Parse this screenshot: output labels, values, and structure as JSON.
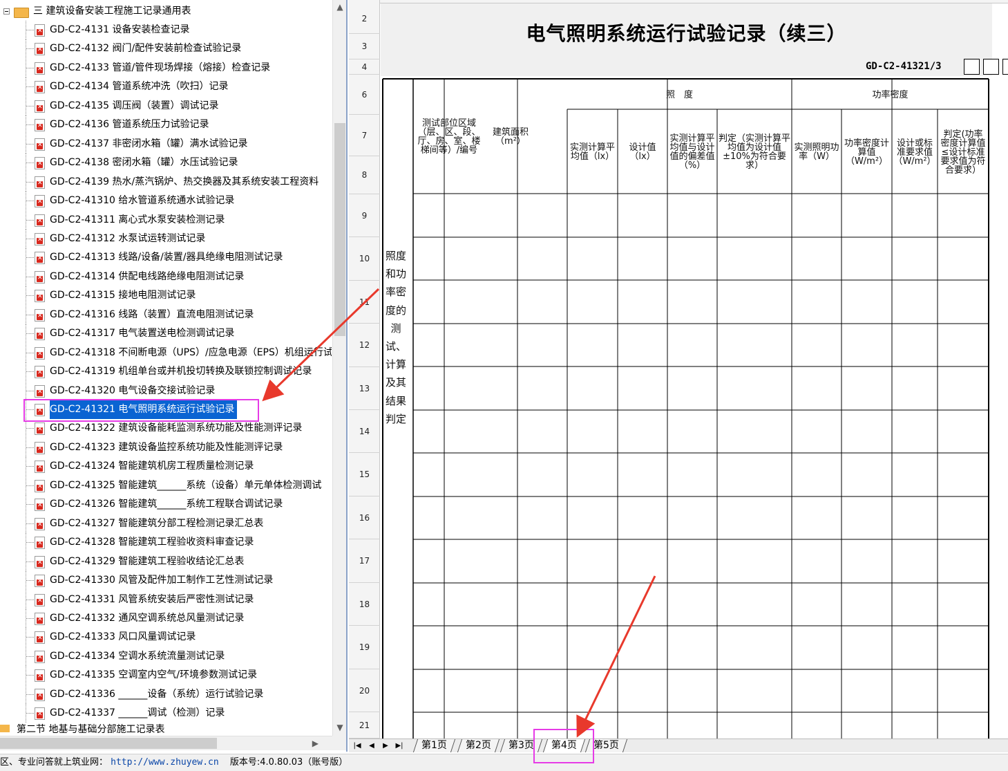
{
  "tree": {
    "folder_label": "三  建筑设备安装工程施工记录通用表",
    "items": [
      "GD-C2-4131 设备安装检查记录",
      "GD-C2-4132 阀门/配件安装前检查试验记录",
      "GD-C2-4133 管道/管件现场焊接（熔接）检查记录",
      "GD-C2-4134 管道系统冲洗（吹扫）记录",
      "GD-C2-4135 调压阀（装置）调试记录",
      "GD-C2-4136 管道系统压力试验记录",
      "GD-C2-4137 非密闭水箱（罐）满水试验记录",
      "GD-C2-4138 密闭水箱（罐）水压试验记录",
      "GD-C2-4139 热水/蒸汽锅炉、热交换器及其系统安装工程资料",
      "GD-C2-41310 给水管道系统通水试验记录",
      "GD-C2-41311 离心式水泵安装检测记录",
      "GD-C2-41312 水泵试运转测试记录",
      "GD-C2-41313 线路/设备/装置/器具绝缘电阻测试记录",
      "GD-C2-41314 供配电线路绝缘电阻测试记录",
      "GD-C2-41315 接地电阻测试记录",
      "GD-C2-41316 线路（装置）直流电阻测试记录",
      "GD-C2-41317 电气装置送电检测调试记录",
      "GD-C2-41318 不间断电源（UPS）/应急电源（EPS）机组运行试",
      "GD-C2-41319 机组单台或并机投切转换及联锁控制调试记录",
      "GD-C2-41320 电气设备交接试验记录",
      "GD-C2-41321 电气照明系统运行试验记录",
      "GD-C2-41322 建筑设备能耗监测系统功能及性能测评记录",
      "GD-C2-41323 建筑设备监控系统功能及性能测评记录",
      "GD-C2-41324 智能建筑机房工程质量检测记录",
      "GD-C2-41325 智能建筑______系统（设备）单元单体检测调试",
      "GD-C2-41326 智能建筑______系统工程联合调试记录",
      "GD-C2-41327 智能建筑分部工程检测记录汇总表",
      "GD-C2-41328 智能建筑工程验收资料审查记录",
      "GD-C2-41329 智能建筑工程验收结论汇总表",
      "GD-C2-41330 风管及配件加工制作工艺性测试记录",
      "GD-C2-41331 风管系统安装后严密性测试记录",
      "GD-C2-41332 通风空调系统总风量测试记录",
      "GD-C2-41333 风口风量调试记录",
      "GD-C2-41334 空调水系统流量测试记录",
      "GD-C2-41335 空调室内空气/环境参数测试记录",
      "GD-C2-41336 ______设备（系统）运行试验记录",
      "GD-C2-41337 ______调试（检测）记录"
    ],
    "selected_index": 20,
    "bottom_partial_label": "第二节  地基与基础分部施工记录表"
  },
  "sheet": {
    "row_numbers": [
      "2",
      "3",
      "4",
      "6",
      "7",
      "8",
      "9",
      "10",
      "11",
      "12",
      "13",
      "14",
      "15",
      "16",
      "17",
      "18",
      "19",
      "20",
      "21"
    ],
    "title": "电气照明系统运行试验记录（续三）",
    "code": "GD-C2-41321/3",
    "group_headers": {
      "illuminance": "照　度",
      "power_density": "功率密度"
    },
    "column_headers": [
      "测试部位区域（层、区、段、厅、房、室、楼梯间等）/编号",
      "建筑面积（m²）",
      "实测计算平均值（lx）",
      "设计值（lx）",
      "实测计算平均值与设计值的偏差值（%）",
      "判定（实测计算平均值为设计值±10%为符合要求）",
      "实测照明功率（W）",
      "功率密度计算值（W/m²）",
      "设计或标准要求值（W/m²）",
      "判定(功率密度计算值≤设计标准要求值为符合要求）"
    ],
    "vertical_label": "照度和功率密度的测试、计算及其结果判定"
  },
  "tabs": {
    "items": [
      "第1页",
      "第2页",
      "第3页",
      "第4页",
      "第5页"
    ],
    "active_index": 3
  },
  "status": {
    "prefix": "区、专业问答就上筑业网：",
    "url": "http://www.zhuyew.cn",
    "version": "版本号:4.0.80.03（账号版）"
  },
  "colors": {
    "selection": "#0a64d2",
    "annotation_box": "#e63be6",
    "annotation_arrow": "#e8392c",
    "title_band": "#f0f0f0"
  },
  "icons": {
    "tree_item": "pdf-file-icon",
    "folder": "folder-icon"
  }
}
